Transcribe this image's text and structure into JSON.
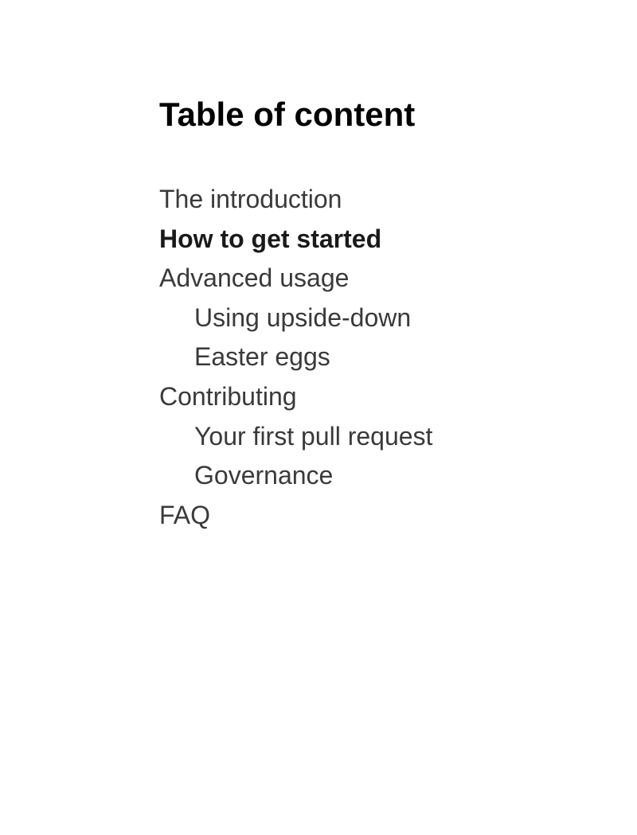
{
  "title": "Table of content",
  "toc": {
    "items": [
      {
        "label": "The introduction",
        "active": false
      },
      {
        "label": "How to get started",
        "active": true
      },
      {
        "label": "Advanced usage",
        "active": false,
        "children": [
          {
            "label": "Using upside-down"
          },
          {
            "label": "Easter eggs"
          }
        ]
      },
      {
        "label": "Contributing",
        "active": false,
        "children": [
          {
            "label": "Your first pull request"
          },
          {
            "label": "Governance"
          }
        ]
      },
      {
        "label": "FAQ",
        "active": false
      }
    ]
  }
}
